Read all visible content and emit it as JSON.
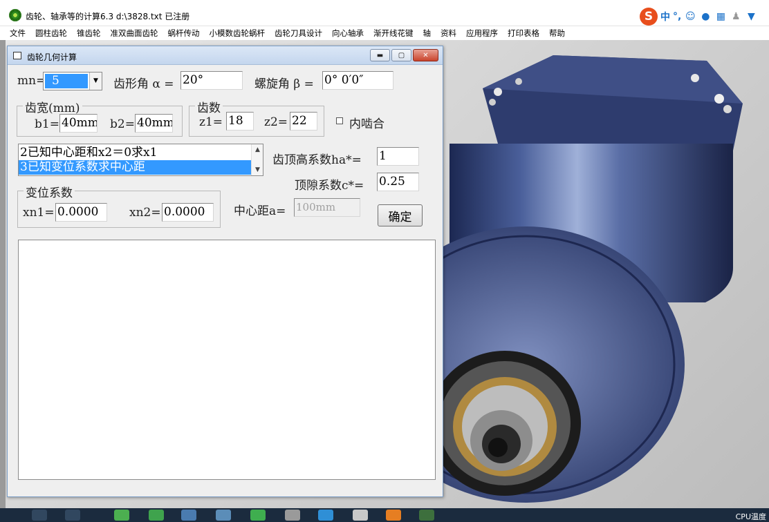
{
  "app": {
    "title": "齿轮、轴承等的计算6.3    d:\\3828.txt 已注册"
  },
  "ime_bar": {
    "logo": "S",
    "mode": "中",
    "punct": "°,",
    "icons": [
      "smile-icon",
      "mic-icon",
      "keyboard-icon",
      "user-icon",
      "shirt-icon"
    ]
  },
  "menu": [
    "文件",
    "圆柱齿轮",
    "锥齿轮",
    "准双曲面齿轮",
    "蜗杆传动",
    "小模数齿轮蜗杆",
    "齿轮刀具设计",
    "向心轴承",
    "渐开线花键",
    "轴",
    "资料",
    "应用程序",
    "打印表格",
    "帮助"
  ],
  "dialog": {
    "title": "齿轮几何计算",
    "mn_label": "mn=",
    "mn_value": "5",
    "pressure_angle_label": "齿形角 α =",
    "pressure_angle_value": "20°",
    "helix_angle_label": "螺旋角 β =",
    "helix_angle_value": "0° 0′0″",
    "face_width_group": "齿宽(mm)",
    "b1_label": "b1=",
    "b1_value": "40mm",
    "b2_label": "b2=",
    "b2_value": "40mm",
    "teeth_group": "齿数",
    "z1_label": "z1=",
    "z1_value": "18",
    "z2_label": "z2=",
    "z2_value": "22",
    "internal_mesh_label": "内啮合",
    "internal_mesh_checked": false,
    "modes": [
      {
        "label": "2已知中心距和x2＝0求x1",
        "selected": false
      },
      {
        "label": "3已知变位系数求中心距",
        "selected": true
      }
    ],
    "addendum_label": "齿顶高系数ha*=",
    "addendum_value": "1",
    "clearance_label": "顶隙系数c*=",
    "clearance_value": "0.25",
    "shift_group": "变位系数",
    "xn1_label": "xn1=",
    "xn1_value": "0.0000",
    "xn2_label": "xn2=",
    "xn2_value": "0.0000",
    "center_distance_label": "中心距a=",
    "center_distance_value": "100mm",
    "ok_button": "确定",
    "output_text": ""
  },
  "taskbar": {
    "cpu_label": "CPU温度"
  },
  "colors": {
    "selection": "#3399ff",
    "motor_blue": "#2d3f73",
    "taskbar": "#1b2b3e"
  }
}
